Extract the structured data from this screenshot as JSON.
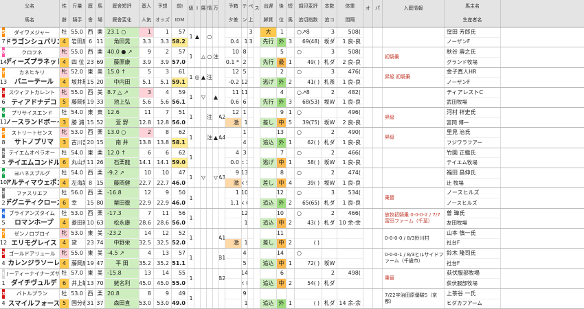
{
  "headers": [
    [
      "父名",
      "馬名"
    ],
    [
      "性",
      "齢"
    ],
    [
      "斤量",
      "騎手"
    ],
    [
      "厩",
      "舎"
    ],
    [
      "馬",
      "場"
    ],
    [
      "厩舎短評",
      "厩舎変化"
    ],
    [
      "基人",
      "人気"
    ],
    [
      "予想",
      "オッズ"
    ],
    [
      "前I",
      "IDM"
    ],
    [
      "級",
      ""
    ],
    [
      "I",
      ""
    ],
    [
      "展",
      ""
    ],
    [
      "情",
      ""
    ],
    [
      "万",
      ""
    ],
    [
      "",
      ""
    ],
    [
      "予箱",
      "夕差"
    ],
    [
      "テ",
      "ン"
    ],
    [
      "ペ",
      "上"
    ],
    [
      "ス",
      ""
    ],
    [
      "出遅",
      "脚質"
    ],
    [
      "後",
      "位"
    ],
    [
      "短",
      "馬"
    ],
    [
      "調印変評",
      "追切指数"
    ],
    [
      "本数",
      "追コ"
    ],
    [
      "体重",
      "間隔"
    ],
    [
      "オ",
      ""
    ],
    [
      "パ",
      ""
    ],
    [
      "入厩情報",
      ""
    ],
    [
      "馬主名",
      "生産者名"
    ]
  ],
  "rows": [
    {
      "waku": "5",
      "waku_color": "#ff8a00",
      "num": "7",
      "sire": "ダイワメジャー",
      "name": "ドラゴンシュバリエ",
      "sex": "牡",
      "age": "4",
      "kin": "55.0",
      "jockey": "岩田康",
      "tr": "西",
      "tr2": "6",
      "ba": "栗",
      "ba2": "11",
      "note": "23.1 ○",
      "note2": "角田晃",
      "kj": "1",
      "kj2": "3.3",
      "ninki": "1",
      "odds": "3.3",
      "idm_t": "57",
      "idm": "58.2",
      "kyu": "1",
      "i": "▲",
      "ten": "",
      "jo": "○",
      "man": "",
      "ex": "",
      "yo": "",
      "yo2": "0.4",
      "te": "",
      "te2": "< 10",
      "pe": "3",
      "pe2": "3",
      "su": "",
      "de": "大",
      "de2": "先行",
      "ko": "1",
      "ko2": "外",
      "ta": "",
      "ta2": "3",
      "ch": "○↗8",
      "ch2": "69(48)",
      "hon": "3",
      "hon2": "坂ダ",
      "we": "508(",
      "we2": "1 良-良",
      "o": "",
      "p": "",
      "info": "",
      "owner": "窪田 芳郎氏",
      "breeder": "ノーザンF"
    },
    {
      "waku": "8",
      "waku_color": "#ff57a6",
      "num": "14",
      "sire": "クロフネ",
      "name": "ディーズプラネット",
      "sex": "牝",
      "age": "4",
      "kin": "55.0",
      "jockey": "四 位",
      "tr": "西",
      "tr2": "23",
      "ba": "栗",
      "ba2": "69",
      "note": "40.0 ● ↗",
      "note2": "藤原康",
      "kj": "9",
      "kj2": "3.9",
      "ninki": "2",
      "odds": "3.9",
      "idm_t": "57",
      "idm": "57.0",
      "kyu": "1",
      "i": "",
      "ten": "△",
      "jo": "○",
      "man": "注",
      "ex": "",
      "yo": "10",
      "yo2": "0.1 *",
      "te": "8",
      "te2": "2",
      "pe": "",
      "pe2": "",
      "su": "",
      "de": "",
      "de2": "先行",
      "ko": "5",
      "ko2": "最",
      "ta": "",
      "ta2": "1",
      "ch": "○",
      "ch2": "49( )",
      "hon": "3",
      "hon2": "札ダ",
      "we": "508(",
      "we2": "2 良-良",
      "o": "",
      "p": "",
      "info": "初騎乗",
      "owner": "秋谷 壽之氏",
      "breeder": "グランド牧場"
    },
    {
      "waku": "7",
      "waku_color": "#ff9a1a",
      "num": "13",
      "sire": "カネヒキリ",
      "name": "バニーテール",
      "sex": "牝",
      "age": "4",
      "kin": "52.0",
      "jockey": "坂井瑠",
      "tr": "東",
      "tr2": "15",
      "ba": "美",
      "ba2": "20",
      "note": "15.0 ↑",
      "note2": "中内田",
      "kj": "5",
      "kj2": "5.1",
      "ninki": "3",
      "odds": "5.1",
      "idm_t": "61",
      "idm": "59.1",
      "kyu": "1",
      "i": "◎",
      "ten": "▲",
      "jo": "注",
      "man": "",
      "ex": "",
      "yo": "12",
      "yo2": "-0.2",
      "te": "5",
      "te2": "12",
      "pe": "",
      "pe2": "",
      "su": "",
      "de": "",
      "de2": "逃げ",
      "ko": "2",
      "ko2": "外",
      "ta": "",
      "ta2": "2",
      "ch": "○",
      "ch2": "41( )",
      "hon": "3",
      "hon2": "札茶",
      "we": "476(",
      "we2": "1 良-良",
      "o": "",
      "p": "",
      "info": "昇級 初騎乗",
      "owner": "金子真人HR",
      "breeder": "ノーザンF"
    },
    {
      "waku": "3",
      "waku_color": "#d61515",
      "num": "6",
      "sire": "スウィフトカレント",
      "name": "ティアドナデコ",
      "sex": "牝",
      "age": "5",
      "kin": "55.0",
      "jockey": "藤岡佑",
      "tr": "西",
      "tr2": "19",
      "ba": "美",
      "ba2": "33",
      "note": "8.7 △ ↗",
      "note2": "池上弘",
      "kj": "3",
      "kj2": "5.6",
      "ninki": "4",
      "odds": "5.6",
      "idm_t": "59",
      "idm": "56.1",
      "kyu": "1",
      "i": "",
      "ten": "▽",
      "jo": "",
      "man": "▲",
      "ex": "",
      "yo": "11",
      "yo2": "0.6",
      "te": "11",
      "te2": "6",
      "pe": "",
      "pe2": "",
      "su": "",
      "de": "",
      "de2": "先行",
      "ko": "4",
      "ko2": "外",
      "ta": "",
      "ta2": "3",
      "ch": "○↗8",
      "ch2": "68(53)",
      "hon": "2",
      "hon2": "坂W",
      "we": "482(",
      "we2": "1 良-良",
      "o": "",
      "p": "",
      "info": "",
      "owner": "ティアレストC",
      "breeder": "武田牧場"
    },
    {
      "waku": "6",
      "waku_color": "#16a34a",
      "num": "11",
      "sire": "プリサイスエンド",
      "name": "ノースランドボーイ",
      "sex": "牡",
      "age": "3",
      "kin": "54.0",
      "jockey": "勝 浦",
      "tr": "東",
      "tr2": "15",
      "ba": "東",
      "ba2": "52",
      "note": "12.6",
      "note2": "萱 野",
      "kj": "11",
      "kj2": "12.8",
      "ninki": "7",
      "odds": "12.8",
      "idm_t": "51",
      "idm": "56.0",
      "kyu": "1",
      "i": "",
      "ten": "",
      "jo": "注",
      "man": "",
      "ex": "A2",
      "yo": "12",
      "yo2": "激",
      "te": "1",
      "te2": "< 12",
      "pe": "",
      "pe2": "",
      "su": "",
      "de": "",
      "de2": "差し",
      "ko": "9",
      "ko2": "中",
      "ta": "1",
      "ta2": "5",
      "ch": "○",
      "ch2": "39(75)",
      "hon": "",
      "hon2": "坂W",
      "we": "496(",
      "we2": "2 良-良",
      "o": "",
      "p": "",
      "info": "昇級",
      "owner": "河村 祥史氏",
      "breeder": "富岡 博一"
    },
    {
      "waku": "5",
      "waku_color": "#ff8a00",
      "num": "8",
      "sire": "ストリートセンス",
      "name": "サトノプリマ",
      "sex": "牝",
      "age": "3",
      "kin": "53.0",
      "jockey": "古川吉",
      "tr": "西",
      "tr2": "20",
      "ba": "栗",
      "ba2": "15",
      "note": "13.0 ○",
      "note2": "南 井",
      "kj": "2",
      "kj2": "13.8",
      "ninki": "8",
      "odds": "13.8",
      "idm_t": "62",
      "idm": "58.1",
      "kyu": "1",
      "i": "",
      "ten": "",
      "jo": "注",
      "man": "▲",
      "ex": "A4",
      "yo": "",
      "yo2": "",
      "te": "1",
      "te2": "4",
      "pe": "",
      "pe2": "",
      "su": "",
      "de": "",
      "de2": "追込",
      "ko": "13",
      "ko2": "外",
      "ta": "",
      "ta2": "1",
      "ch": "○",
      "ch2": "62( )",
      "hon": "2",
      "hon2": "札ダ",
      "we": "490(",
      "we2": "1 良-良",
      "o": "",
      "p": "",
      "info": "昇級",
      "owner": "里見 治氏",
      "breeder": "フジワラフアー"
    },
    {
      "waku": "2",
      "waku_color": "#777777",
      "num": "3",
      "sire": "テイエムオペラオー",
      "name": "テイエムコンドル",
      "sex": "牡",
      "age": "6",
      "kin": "54.0",
      "jockey": "丸山元",
      "tr": "東",
      "tr2": "11",
      "ba": "栗",
      "ba2": "26",
      "note": "12.0 ↑",
      "note2": "石栗龍",
      "kj": "6",
      "kj2": "14.1",
      "ninki": "6",
      "odds": "14.1",
      "idm_t": "62",
      "idm": "59.0",
      "kyu": "1",
      "i": "",
      "ten": "",
      "jo": "",
      "man": "",
      "ex": "",
      "yo": "4",
      "yo2": "0.0",
      "te": "3",
      "te2": "< 2",
      "pe": "",
      "pe2": "",
      "su": "",
      "de": "",
      "de2": "逃げ",
      "ko": "7",
      "ko2": "中",
      "ta": "",
      "ta2": "1",
      "ch": "○",
      "ch2": "58( )",
      "hon": "2",
      "hon2": "坂W",
      "we": "466(",
      "we2": "1 良-良",
      "o": "",
      "p": "",
      "info": "",
      "owner": "竹園 正繼氏",
      "breeder": "テイエム牧場"
    },
    {
      "waku": "6",
      "waku_color": "#16a34a",
      "num": "10",
      "sire": "ヨハネスブルグ",
      "name": "アルティマウェポン",
      "sex": "牡",
      "age": "4",
      "kin": "54.0",
      "jockey": "左海誠",
      "tr": "西",
      "tr2": "8",
      "ba": "栗",
      "ba2": "15",
      "note": "-9.2 ↗",
      "note2": "藤岡健",
      "kj": "10",
      "kj2": "22.7",
      "ninki": "10",
      "odds": "22.7",
      "idm_t": "47",
      "idm": "46.0",
      "kyu": "1",
      "i": "",
      "ten": "▽",
      "jo": "",
      "man": "▽",
      "ex": "A3",
      "yo": "9",
      "yo2": "激",
      "te": "13",
      "te2": "< 9",
      "pe": "",
      "pe2": "",
      "su": "",
      "de": "",
      "de2": "差し",
      "ko": "8",
      "ko2": "中",
      "ta": "",
      "ta2": "4",
      "ch": "○",
      "ch2": "39( )",
      "hon": "2",
      "hon2": "坂W",
      "we": "474(",
      "we2": "1 良-良",
      "o": "",
      "p": "",
      "info": "",
      "owner": "福田 昌伸氏",
      "breeder": "辻 牧場"
    },
    {
      "waku": "2",
      "waku_color": "#777777",
      "num": "2",
      "sire": "ファスリエフ",
      "name": "デグニティクローズ",
      "sex": "牡",
      "age": "6",
      "kin": "56.0",
      "jockey": "幸",
      "tr": "西",
      "tr2": "15",
      "ba": "栗",
      "ba2": "80",
      "note": "-16.8",
      "note2": "栗田徹",
      "kj": "12",
      "kj2": "22.9",
      "ninki": "9",
      "odds": "22.9",
      "idm_t": "50",
      "idm": "46.0",
      "kyu": "1",
      "i": "",
      "ten": "",
      "jo": "",
      "man": "",
      "ex": "",
      "yo": "1",
      "yo2": "1.1",
      "te": "10",
      "te2": "< 6",
      "pe": "",
      "pe2": "",
      "su": "",
      "de": "",
      "de2": "追込",
      "ko": "12",
      "ko2": "外",
      "ta": "",
      "ta2": "2",
      "ch": "○",
      "ch2": "65(65)",
      "hon": "3",
      "hon2": "札ダ",
      "we": "534(",
      "we2": "1 良-良",
      "o": "",
      "p": "",
      "info": "乗替",
      "owner": "ノースヒルズ",
      "breeder": "ノースヒルズ"
    },
    {
      "waku": "4",
      "waku_color": "#2b6fe0",
      "num": "5",
      "sire": "ブライアンズタイム",
      "name": "ロマンホープ",
      "sex": "牡",
      "age": "4",
      "kin": "53.0",
      "jockey": "菱田裕",
      "tr": "西",
      "tr2": "10",
      "ba": "栗",
      "ba2": "63",
      "note": "-17.3",
      "note2": "松永康",
      "kj": "7",
      "kj2": "28.6",
      "ninki": "11",
      "odds": "28.6",
      "idm_t": "56",
      "idm": "56.0",
      "kyu": "1",
      "i": "",
      "ten": "",
      "jo": "",
      "man": "",
      "ex": "",
      "yo": "",
      "yo2": "",
      "te": "12",
      "te2": "< 12",
      "pe": "",
      "pe2": "",
      "su": "",
      "de": "",
      "de2": "追込",
      "ko": "10",
      "ko2": "中",
      "ta": "",
      "ta2": "2",
      "ch": "○",
      "ch2": "43( )",
      "hon": "2",
      "hon2": "札ダ",
      "we": "466(",
      "we2": "10 余-余",
      "o": "",
      "p": "",
      "info": "放牧初騎乗 0-0-0-2 / 7/7富田ファーム（千葉）",
      "owner": "曽 瑋氏",
      "breeder": "友田牧場"
    },
    {
      "waku": "7",
      "waku_color": "#ff9a1a",
      "num": "12",
      "sire": "ゼンノロブロイ",
      "name": "エリモグレイス",
      "sex": "牝",
      "age": "4",
      "kin": "53.0",
      "jockey": "黛",
      "tr": "東",
      "tr2": "23",
      "ba": "美",
      "ba2": "74",
      "note": "-23.2",
      "note2": "中野栄",
      "kj": "14",
      "kj2": "32.5",
      "ninki": "12",
      "odds": "32.5",
      "idm_t": "52",
      "idm": "52.0",
      "kyu": "1",
      "i": "",
      "ten": "",
      "jo": "",
      "man": "",
      "ex": "A1",
      "yo": "",
      "yo2": "激",
      "te": "",
      "te2": "< 13",
      "pe": "",
      "pe2": "",
      "su": "",
      "de": "",
      "de2": "差し",
      "ko": "11",
      "ko2": "中",
      "ta": "",
      "ta2": "2",
      "ch": "",
      "ch2": "( )",
      "hon": "",
      "hon2": "",
      "we": "",
      "we2": "",
      "o": "",
      "p": "",
      "info": "0-0-0-0 / 8/3鈴川村",
      "owner": "山本 慎一氏",
      "breeder": "社台F"
    },
    {
      "waku": "3",
      "waku_color": "#d61515",
      "num": "4",
      "sire": "ゴールドアリュール",
      "name": "カレンジラソーレ",
      "sex": "牝",
      "age": "4",
      "kin": "55.0",
      "jockey": "藤岡康",
      "tr": "東",
      "tr2": "19",
      "ba": "美",
      "ba2": "47",
      "note": "-4.5 ↗",
      "note2": "平 田",
      "kj": "4",
      "kj2": "35.2",
      "ninki": "13",
      "odds": "35.2",
      "idm_t": "57",
      "idm": "51.1",
      "kyu": "1",
      "i": "",
      "ten": "",
      "jo": "",
      "man": "",
      "ex": "B1",
      "yo": "",
      "yo2": "",
      "te": "4",
      "te2": "5",
      "pe": "",
      "pe2": "",
      "su": "",
      "de": "",
      "de2": "追込",
      "ko": "14",
      "ko2": "中",
      "ta": "",
      "ta2": "1",
      "ch": "○",
      "ch2": "72( )",
      "hon": "",
      "hon2": "坂W",
      "we": "",
      "we2": "",
      "o": "",
      "p": "",
      "info": "0-0-0-1 / 8/3ヒルサイドファーム（千歳市）",
      "owner": "鈴木 隆司氏",
      "breeder": "社台F"
    },
    {
      "waku": "1",
      "waku_color": "#d8d8d8",
      "num": "1",
      "sire": "フォーティーナイナーズサン",
      "name": "ダイチヴュルデ",
      "sex": "牡",
      "age": "6",
      "kin": "57.0",
      "jockey": "井上敏",
      "tr": "東",
      "tr2": "13",
      "ba": "美",
      "ba2": "70",
      "note": "-15.8",
      "note2": "蛯名利",
      "kj": "13",
      "kj2": "45.0",
      "ninki": "14",
      "odds": "45.0",
      "idm_t": "55",
      "idm": "55.0",
      "kyu": "1",
      "i": "",
      "ten": "",
      "jo": "",
      "man": "",
      "ex": "B2",
      "yo": "",
      "yo2": "",
      "te": "14",
      "te2": "< 8",
      "pe": "",
      "pe2": "",
      "su": "",
      "de": "",
      "de2": "追込",
      "ko": "6",
      "ko2": "中",
      "ta": "",
      "ta2": "2",
      "ch": "",
      "ch2": "54( )",
      "hon": "2",
      "hon2": "札ダ",
      "we": "498(",
      "we2": "",
      "o": "",
      "p": "",
      "info": "乗替",
      "owner": "荻伏服部牧場",
      "breeder": "荻伏服部牧場"
    },
    {
      "waku": "3",
      "waku_color": "#d61515",
      "num": "4",
      "sire": "バトルプラン",
      "name": "スマイルフォース",
      "sex": "牡",
      "age": "5",
      "kin": "53.0",
      "jockey": "国分恭",
      "tr": "西",
      "tr2": "31",
      "ba": "栗",
      "ba2": "37",
      "note": "20.8",
      "note2": "森田直",
      "kj": "8",
      "kj2": "53.0",
      "ninki": "9",
      "odds": "53.0",
      "idm_t": "49",
      "idm": "49.0",
      "kyu": "1",
      "i": "",
      "ten": "",
      "jo": "",
      "man": "",
      "ex": "",
      "yo": "",
      "yo2": "",
      "te": "9",
      "te2": "< 11",
      "pe": "",
      "pe2": "",
      "su": "",
      "de": "",
      "de2": "追込",
      "ko": "",
      "ko2": "外",
      "ta": "",
      "ta2": "1",
      "ch": "",
      "ch2": "( )",
      "hon": "",
      "hon2": "札ダ",
      "we": "",
      "we2": "14 余-余",
      "o": "",
      "p": "",
      "info": "7/22宇治田原優駿S（京都）",
      "owner": "上茶谷 一氏",
      "breeder": "ヒダカフアーム"
    }
  ]
}
